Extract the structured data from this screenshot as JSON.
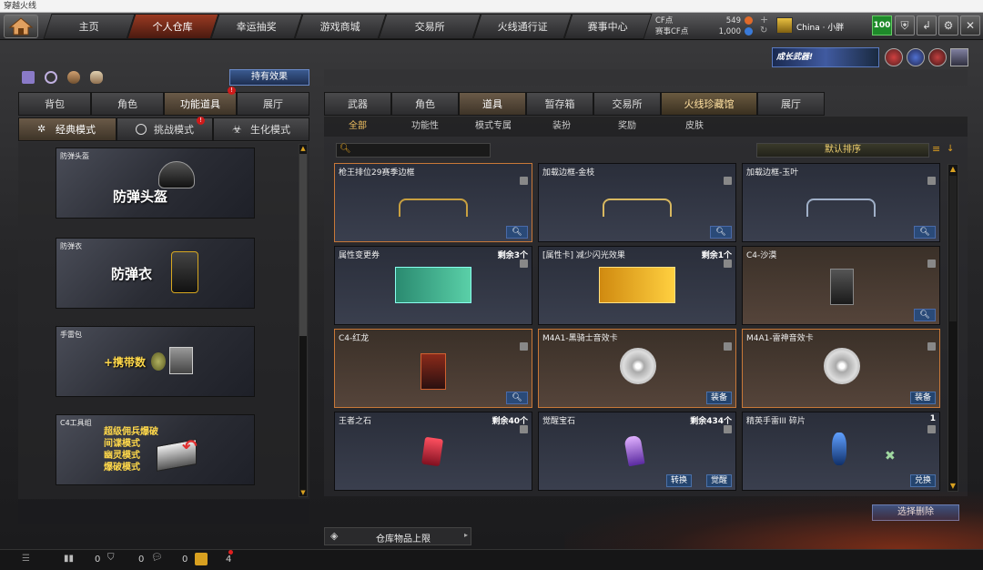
{
  "window": {
    "title": "穿越火线"
  },
  "nav": {
    "tabs": [
      "主页",
      "个人仓库",
      "幸运抽奖",
      "游戏商城",
      "交易所",
      "火线通行证",
      "赛事中心"
    ],
    "points": {
      "cf_label": "CF点",
      "cf_value": "549",
      "game_cf_label": "赛事CF点",
      "game_cf_value": "1,000"
    },
    "user": "China · 小胖",
    "level": "100"
  },
  "banner": {
    "text": "成长武器!"
  },
  "left": {
    "effects_button": "持有效果",
    "tabs": [
      "背包",
      "角色",
      "功能道具",
      "展厅"
    ],
    "modes": [
      "经典模式",
      "挑战模式",
      "生化模式"
    ],
    "cards": [
      {
        "title": "防弹头盔",
        "big": "防弹头盔"
      },
      {
        "title": "防弹衣",
        "big": "防弹衣"
      },
      {
        "title": "手雷包",
        "big": "+携带数"
      },
      {
        "title": "C4工具组",
        "lines": [
          "超级佣兵爆破",
          "间谍模式",
          "幽灵模式",
          "爆破模式"
        ]
      }
    ]
  },
  "right": {
    "tabs": [
      "武器",
      "角色",
      "道具",
      "暂存箱",
      "交易所",
      "火线珍藏馆",
      "展厅"
    ],
    "subtabs": [
      "全部",
      "功能性",
      "模式专属",
      "装扮",
      "奖励",
      "皮肤"
    ],
    "sort_label": "默认排序",
    "items": [
      {
        "name": "枪王排位29赛季边框",
        "count": "",
        "btns": []
      },
      {
        "name": "加载边框-金枝",
        "count": "",
        "btns": []
      },
      {
        "name": "加载边框-玉叶",
        "count": "",
        "btns": []
      },
      {
        "name": "属性变更券",
        "count": "剩余3个",
        "btns": []
      },
      {
        "name": "[属性卡] 减少闪光效果",
        "count": "剩余1个",
        "btns": []
      },
      {
        "name": "C4-沙漠",
        "count": "",
        "btns": []
      },
      {
        "name": "C4-红龙",
        "count": "",
        "btns": []
      },
      {
        "name": "M4A1-黑骑士音效卡",
        "count": "",
        "btns": [
          "装备"
        ]
      },
      {
        "name": "M4A1-雷神音效卡",
        "count": "",
        "btns": [
          "装备"
        ]
      },
      {
        "name": "王者之石",
        "count": "剩余40个",
        "btns": []
      },
      {
        "name": "觉醒宝石",
        "count": "剩余434个",
        "btns": [
          "转换",
          "觉醒"
        ]
      },
      {
        "name": "精英手雷III 碎片",
        "count": "1",
        "btns": [
          "兑换"
        ]
      }
    ],
    "delete_button": "选择删除",
    "capacity_label": "仓库物品上限"
  },
  "bottom": {
    "counts": [
      "0",
      "0",
      "0",
      "4"
    ]
  }
}
